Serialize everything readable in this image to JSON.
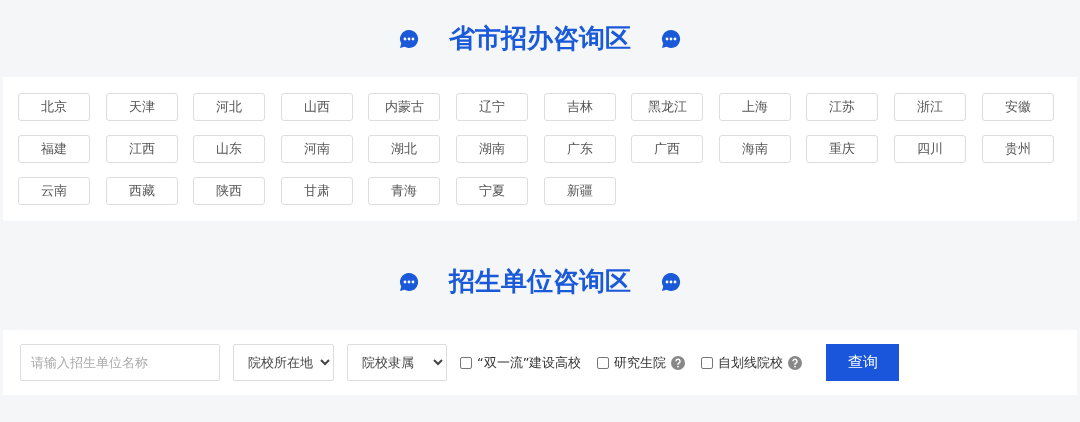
{
  "province_section": {
    "title": "省市招办咨询区",
    "provinces": [
      "北京",
      "天津",
      "河北",
      "山西",
      "内蒙古",
      "辽宁",
      "吉林",
      "黑龙江",
      "上海",
      "江苏",
      "浙江",
      "安徽",
      "福建",
      "江西",
      "山东",
      "河南",
      "湖北",
      "湖南",
      "广东",
      "广西",
      "海南",
      "重庆",
      "四川",
      "贵州",
      "云南",
      "西藏",
      "陕西",
      "甘肃",
      "青海",
      "宁夏",
      "新疆"
    ]
  },
  "unit_section": {
    "title": "招生单位咨询区",
    "search": {
      "placeholder": "请输入招生单位名称"
    },
    "selects": [
      {
        "value": "院校所在地"
      },
      {
        "value": "院校隶属"
      }
    ],
    "checkboxes": [
      {
        "label": "“双一流”建设高校",
        "checked": false,
        "help": false
      },
      {
        "label": "研究生院",
        "checked": false,
        "help": true
      },
      {
        "label": "自划线院校",
        "checked": false,
        "help": true
      }
    ],
    "button": "查询"
  }
}
